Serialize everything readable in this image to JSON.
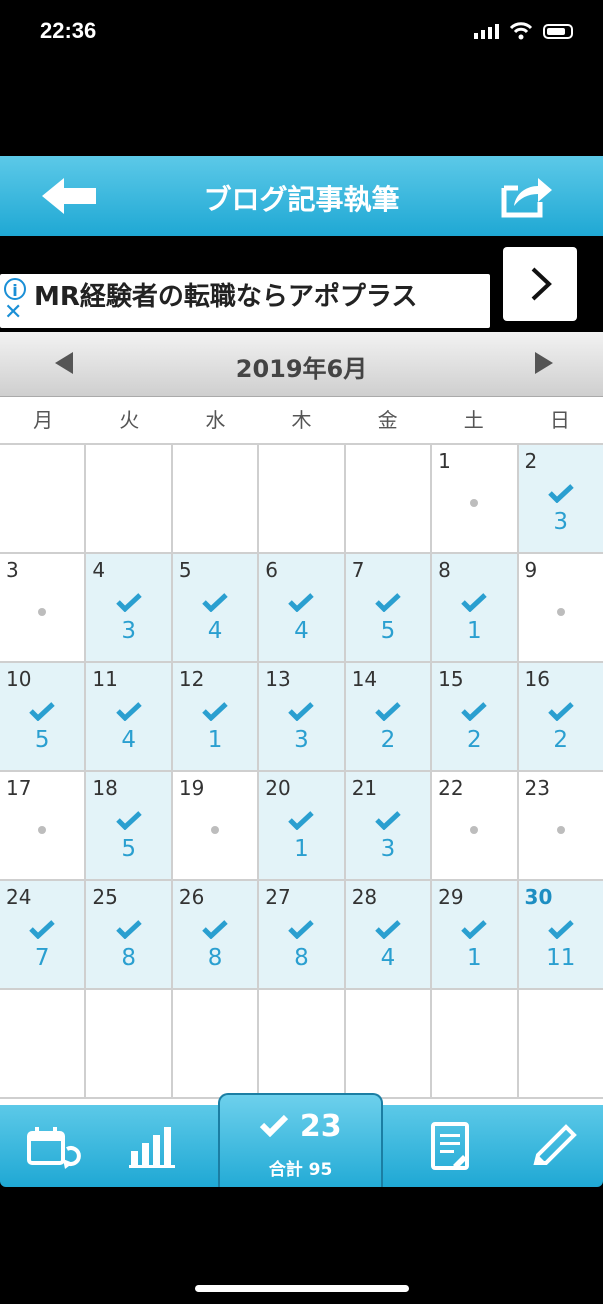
{
  "status_bar": {
    "time": "22:36"
  },
  "header": {
    "title": "ブログ記事執筆"
  },
  "ad": {
    "text": "MR経験者の転職ならアポプラス",
    "info_glyph": "i",
    "close_glyph": "✕"
  },
  "calendar": {
    "month_label": "2019年6月",
    "weekdays": [
      "月",
      "火",
      "水",
      "木",
      "金",
      "土",
      "日"
    ],
    "weeks": [
      [
        null,
        null,
        null,
        null,
        null,
        {
          "day": "1",
          "count": null
        },
        {
          "day": "2",
          "count": "3"
        }
      ],
      [
        {
          "day": "3",
          "count": null
        },
        {
          "day": "4",
          "count": "3"
        },
        {
          "day": "5",
          "count": "4"
        },
        {
          "day": "6",
          "count": "4"
        },
        {
          "day": "7",
          "count": "5"
        },
        {
          "day": "8",
          "count": "1"
        },
        {
          "day": "9",
          "count": null
        }
      ],
      [
        {
          "day": "10",
          "count": "5"
        },
        {
          "day": "11",
          "count": "4"
        },
        {
          "day": "12",
          "count": "1"
        },
        {
          "day": "13",
          "count": "3"
        },
        {
          "day": "14",
          "count": "2"
        },
        {
          "day": "15",
          "count": "2"
        },
        {
          "day": "16",
          "count": "2"
        }
      ],
      [
        {
          "day": "17",
          "count": null
        },
        {
          "day": "18",
          "count": "5"
        },
        {
          "day": "19",
          "count": null
        },
        {
          "day": "20",
          "count": "1"
        },
        {
          "day": "21",
          "count": "3"
        },
        {
          "day": "22",
          "count": null
        },
        {
          "day": "23",
          "count": null
        }
      ],
      [
        {
          "day": "24",
          "count": "7"
        },
        {
          "day": "25",
          "count": "8"
        },
        {
          "day": "26",
          "count": "8"
        },
        {
          "day": "27",
          "count": "8"
        },
        {
          "day": "28",
          "count": "4"
        },
        {
          "day": "29",
          "count": "1"
        },
        {
          "day": "30",
          "count": "11",
          "today": true
        }
      ],
      [
        null,
        null,
        null,
        null,
        null,
        null,
        null
      ]
    ]
  },
  "toolbar": {
    "today_count": "23",
    "total_label": "合計 95"
  },
  "colors": {
    "accent": "#1fa8d4",
    "done_cell": "#e3f3f8",
    "count_text": "#2a9fd0"
  }
}
